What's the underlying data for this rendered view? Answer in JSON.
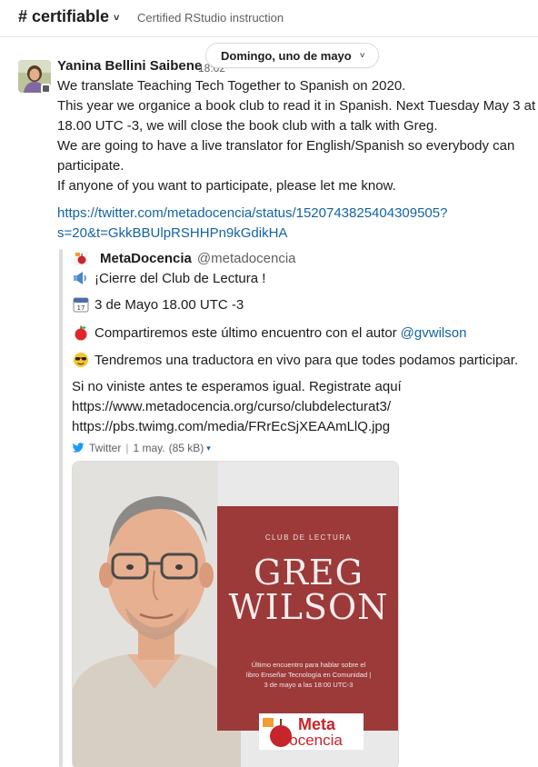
{
  "header": {
    "channel": "# certifiable",
    "channel_chevron": "˅",
    "topic": "Certified RStudio instruction"
  },
  "date_divider": {
    "label": "Domingo, uno de mayo",
    "chevron": "˅"
  },
  "message": {
    "author": "Yanina Bellini Saibene",
    "timestamp": "18:02",
    "lines": [
      "We translate Teaching Tech Together to Spanish on 2020.",
      "This year we organice a book club to read it in Spanish.  Next Tuesday May 3 at",
      "18.00 UTC -3, we will close the book club with a talk with Greg.",
      "We are going to have a live translator for English/Spanish so everybody can",
      "participate.",
      "If anyone of you want to participate, please let me know."
    ],
    "link_lines": [
      "https://twitter.com/metadocencia/status/1520743825404309505?",
      "s=20&t=GkkBBUlpRSHHPn9kGdikHA"
    ]
  },
  "attachment": {
    "source_name": "MetaDocencia",
    "source_handle": "@metadocencia",
    "lines": [
      {
        "icon": "speaker-icon",
        "text": "¡Cierre del Club de Lectura !"
      },
      {
        "icon": "calendar-icon",
        "text": "3 de Mayo 18.00 UTC -3"
      },
      {
        "icon": "apple-icon",
        "text": "Compartiremos este último encuentro con el autor ",
        "mention": "@gvwilson"
      },
      {
        "icon": "sunglasses-icon",
        "text": "Tendremos una traductora en vivo para que todes podamos participar."
      }
    ],
    "closing_text": "Si no viniste antes te esperamos igual. Registrate aquí",
    "urls": [
      "https://www.metadocencia.org/curso/clubdelecturat3/",
      "https://pbs.twimg.com/media/FRrEcSjXEAAmLlQ.jpg"
    ],
    "footer": {
      "service": "Twitter",
      "date": "1 may.",
      "size": "(85 kB)",
      "caret": "▾"
    },
    "image": {
      "club_label": "CLUB DE LECTURA",
      "name_line1": "GREG",
      "name_line2": "WILSON",
      "description": "Último encuentro para hablar sobre el libro Enseñar Tecnología en Comunidad | 3 de mayo a las 18:00 UTC-3",
      "logo_line1": "Meta",
      "logo_line2": "Docencia"
    }
  },
  "colors": {
    "link": "#1264a3",
    "poster_red": "#9c3a3a",
    "logo_red": "#c6252b",
    "twitter_blue": "#1d9bf0"
  }
}
